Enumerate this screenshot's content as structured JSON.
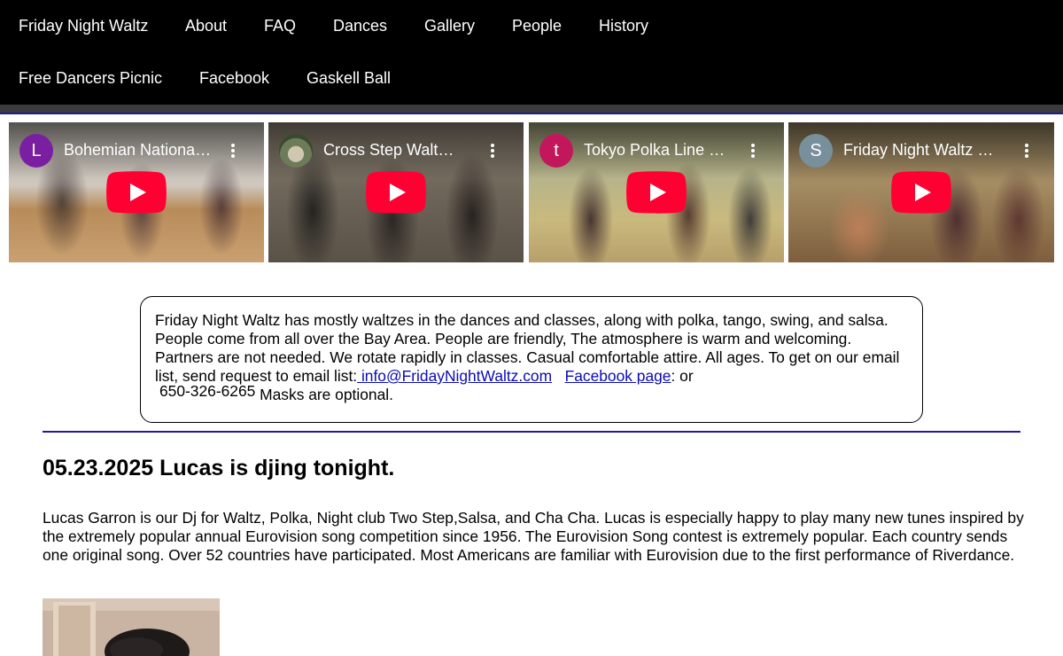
{
  "nav": {
    "row1": [
      "Friday Night Waltz",
      "About",
      "FAQ",
      "Dances",
      "Gallery",
      "People",
      "History"
    ],
    "row2": [
      "Free Dancers Picnic",
      "Facebook",
      "Gaskell Ball"
    ]
  },
  "videos": [
    {
      "avatar": "L",
      "avatar_color": "#7b1fa2",
      "title": "Bohemian National Hall Waltz"
    },
    {
      "avatar": "",
      "avatar_color": "#6d7b58",
      "title": "Cross Step Waltz at Friday Night Waltz"
    },
    {
      "avatar": "t",
      "avatar_color": "#c2185b",
      "title": "Tokyo Polka Line Dance"
    },
    {
      "avatar": "S",
      "avatar_color": "#78909c",
      "title": "Friday Night Waltz Foxtrot"
    }
  ],
  "info": {
    "text": "Friday Night Waltz has mostly waltzes in the dances and classes, along with polka, tango, swing, and salsa. People come from all over the Bay Area. People are friendly, The atmosphere is warm and welcoming. Partners are not needed. We rotate rapidly in classes. Casual comfortable attire. All ages. To get on our email list, send request to email list:",
    "email_link": " info@FridayNightWaltz.com",
    "facebook_link": "Facebook page",
    "or_text": ": or",
    "phone": "650-326-6265",
    "masks": " Masks are optional."
  },
  "post": {
    "headline": "05.23.2025 Lucas is djing tonight.",
    "body": "Lucas Garron is our Dj for Waltz, Polka, Night club Two Step,Salsa, and  Cha Cha. Lucas is especially happy to play many new tunes inspired by the extremely popular annual Eurovision song competition since 1956. The Eurovision Song contest is extremely popular. Each country sends one original song. Over 52 countries have participated. Most Americans are familiar with Eurovision due to the first performance of Riverdance."
  },
  "colors": {
    "nav_bg": "#000000",
    "accent_line": "#1a1aa6",
    "link": "#0b0bb5",
    "play_red": "#ff0033"
  },
  "icons": [
    "play-icon",
    "more-vert-icon"
  ]
}
